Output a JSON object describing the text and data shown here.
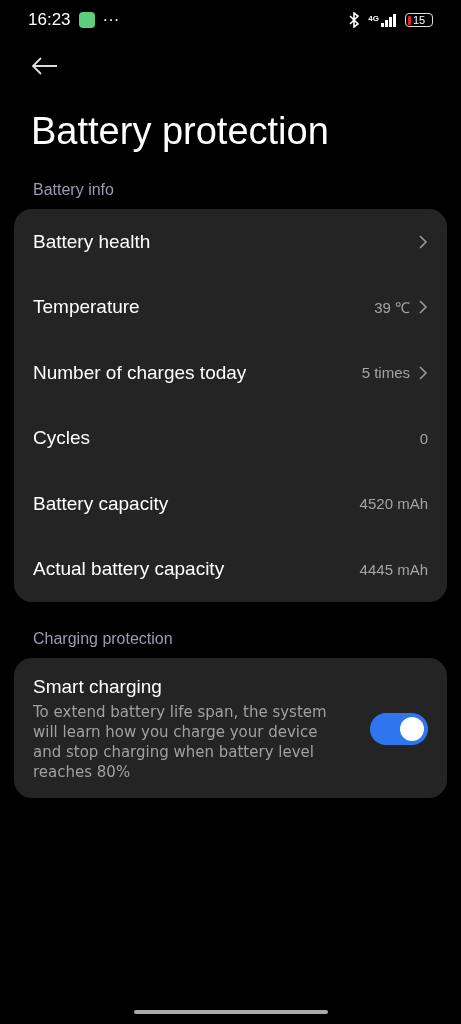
{
  "status_bar": {
    "time": "16:23",
    "more": "···",
    "network": "4G",
    "battery": "15"
  },
  "title": "Battery protection",
  "sections": [
    {
      "header": "Battery info",
      "rows": [
        {
          "kind": "nav",
          "label": "Battery health",
          "chevron": true
        },
        {
          "kind": "nav",
          "label": "Temperature",
          "value": "39 ℃",
          "chevron": true
        },
        {
          "kind": "nav",
          "label": "Number of charges today",
          "value": "5 times",
          "chevron": true
        },
        {
          "kind": "info",
          "label": "Cycles",
          "value": "0",
          "chevron": false
        },
        {
          "kind": "info",
          "label": "Battery capacity",
          "value": "4520 mAh",
          "chevron": false
        },
        {
          "kind": "info",
          "label": "Actual battery capacity",
          "value": "4445 mAh",
          "chevron": false
        }
      ]
    },
    {
      "header": "Charging protection",
      "rows": [
        {
          "kind": "toggle",
          "label": "Smart charging",
          "description": "To extend battery life span, the system will learn how you charge your device and stop charging when battery level reaches 80%",
          "on": true
        }
      ]
    }
  ]
}
